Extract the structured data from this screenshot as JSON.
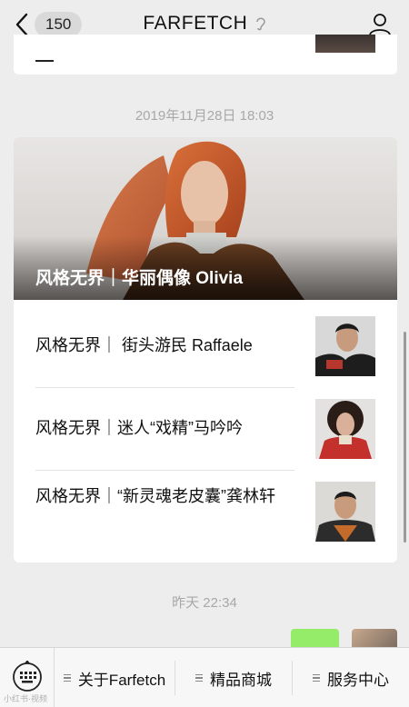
{
  "header": {
    "back_icon": "chevron-left-icon",
    "badge": "150",
    "title": "FARFETCH",
    "ear_icon": "ear-icon",
    "user_icon": "person-icon"
  },
  "timestamps": {
    "first": "2019年11月28日 18:03",
    "second": "昨天 22:34"
  },
  "article": {
    "hero_title": "风格无界｜华丽偶像 Olivia",
    "items": [
      {
        "title": "风格无界｜ 街头游民 Raffaele"
      },
      {
        "title": "风格无界｜迷人“戏精”马吟吟"
      },
      {
        "title": "风格无界｜“新灵魂老皮囊”龚林轩"
      }
    ]
  },
  "menu": {
    "keyboard_icon": "keyboard-icon",
    "items": [
      {
        "label": "关于Farfetch"
      },
      {
        "label": "精品商城"
      },
      {
        "label": "服务中心"
      }
    ]
  },
  "watermark": "小红书·视频"
}
